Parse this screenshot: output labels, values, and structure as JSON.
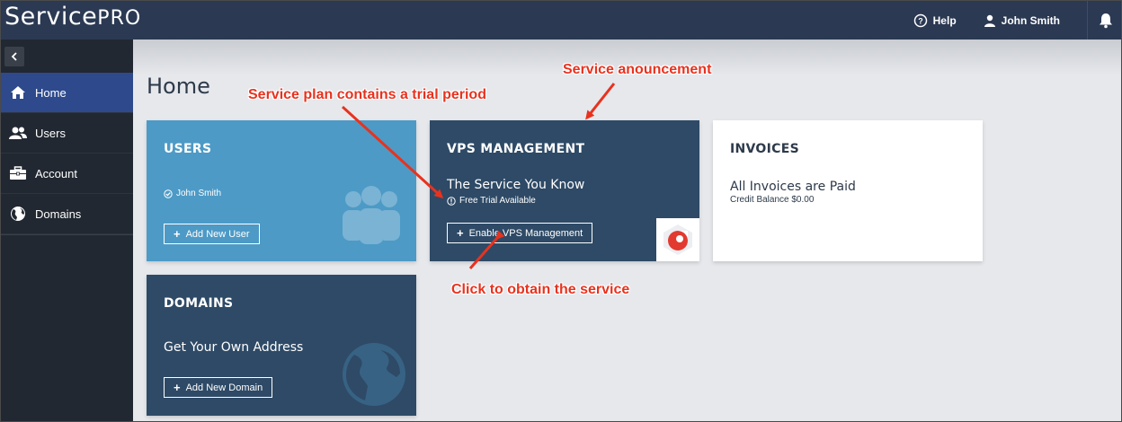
{
  "app": {
    "logo_service": "Service",
    "logo_pro": "PRO"
  },
  "topbar": {
    "help_label": "Help",
    "user_label": "John Smith",
    "icons": [
      "help-circle-icon",
      "user-icon",
      "bell-icon"
    ]
  },
  "sidebar": {
    "items": [
      {
        "label": "Home",
        "icon": "home-icon",
        "active": true
      },
      {
        "label": "Users",
        "icon": "users-icon",
        "active": false
      },
      {
        "label": "Account",
        "icon": "briefcase-icon",
        "active": false
      },
      {
        "label": "Domains",
        "icon": "globe-icon",
        "active": false
      }
    ]
  },
  "main": {
    "title": "Home",
    "cards": {
      "users": {
        "title": "USERS",
        "user_name": "John Smith",
        "button": "Add New User",
        "color": "#4d9ac6"
      },
      "vps": {
        "title": "VPS MANAGEMENT",
        "headline": "The Service You Know",
        "trial_note": "Free Trial Available",
        "button": "Enable VPS Management",
        "color": "#2e4a66"
      },
      "invoices": {
        "title": "INVOICES",
        "headline": "All Invoices are Paid",
        "credit": "Credit Balance $0.00"
      },
      "domains": {
        "title": "DOMAINS",
        "headline": "Get Your Own Address",
        "button": "Add New Domain",
        "color": "#2e4a66"
      }
    }
  },
  "annotations": {
    "trial": "Service plan contains a trial period",
    "announcement": "Service anouncement",
    "obtain": "Click to obtain the service",
    "color": "#e8321e"
  }
}
